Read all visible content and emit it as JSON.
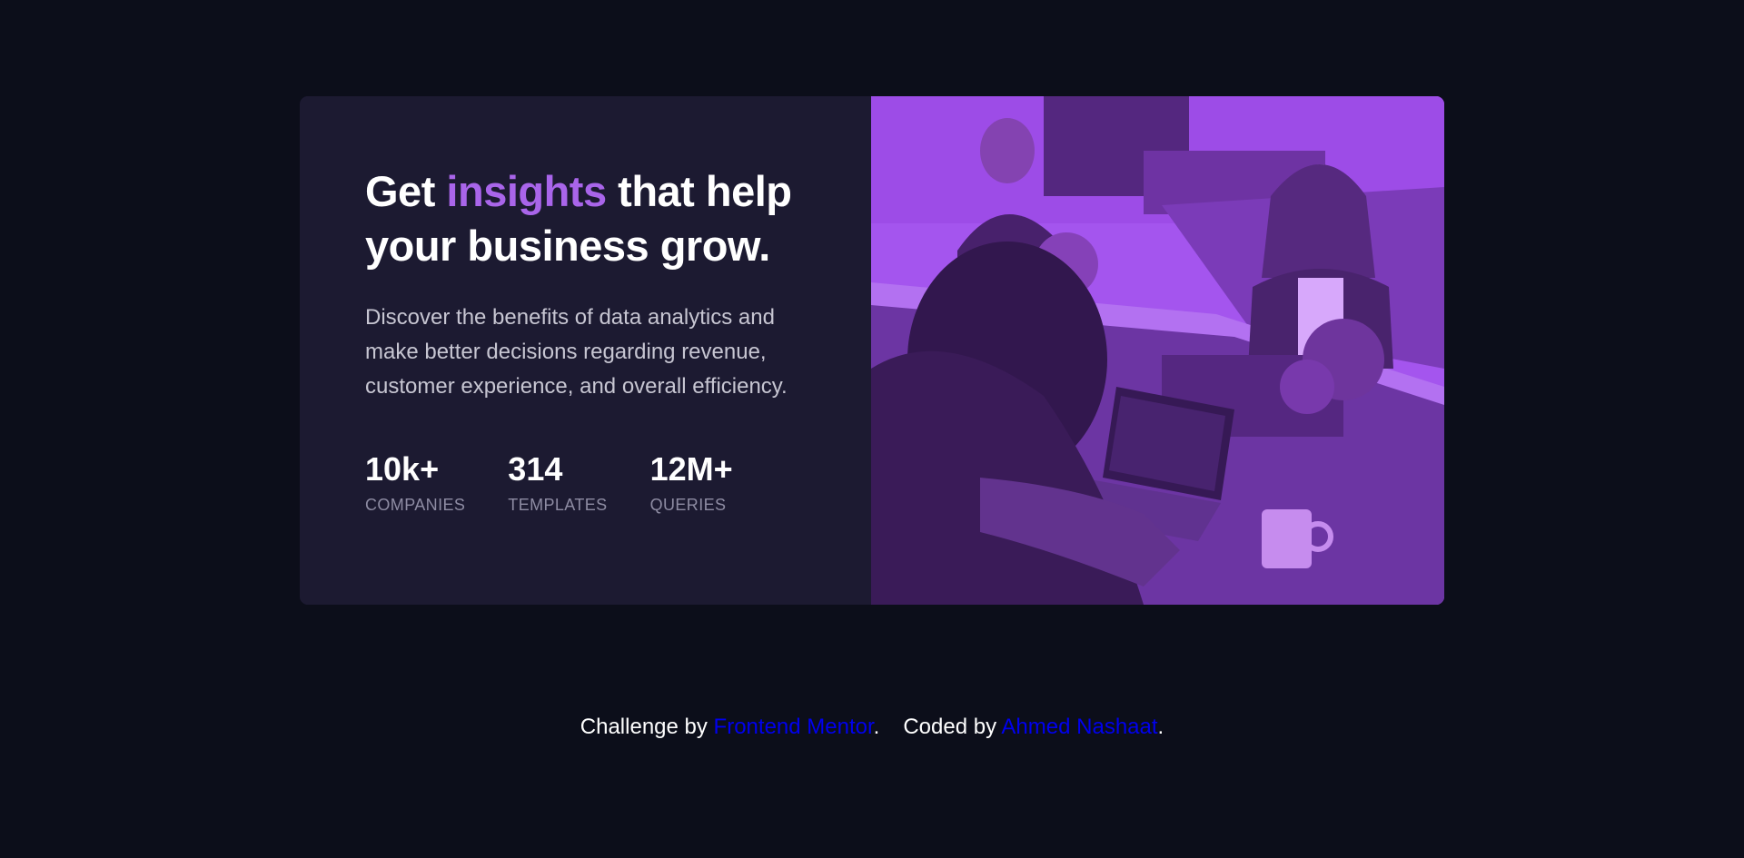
{
  "card": {
    "headline": {
      "before": "Get ",
      "accent": "insights",
      "after": " that help your business grow."
    },
    "description": "Discover the benefits of data analytics and make better decisions regarding revenue, customer experience, and overall efficiency.",
    "stats": [
      {
        "value": "10k+",
        "label": "COMPANIES"
      },
      {
        "value": "314",
        "label": "TEMPLATES"
      },
      {
        "value": "12M+",
        "label": "QUERIES"
      }
    ],
    "image": {
      "overlay_color": "#a24ef0"
    }
  },
  "footer": {
    "challenge_prefix": "Challenge by ",
    "challenge_link": "Frontend Mentor",
    "period1": ".",
    "coded_prefix": "Coded by ",
    "coded_link": "Ahmed Nashaat",
    "period2": "."
  },
  "colors": {
    "background": "#0c0e1a",
    "card": "#1c1a31",
    "accent": "#a965ea",
    "link": "#0000ee"
  }
}
